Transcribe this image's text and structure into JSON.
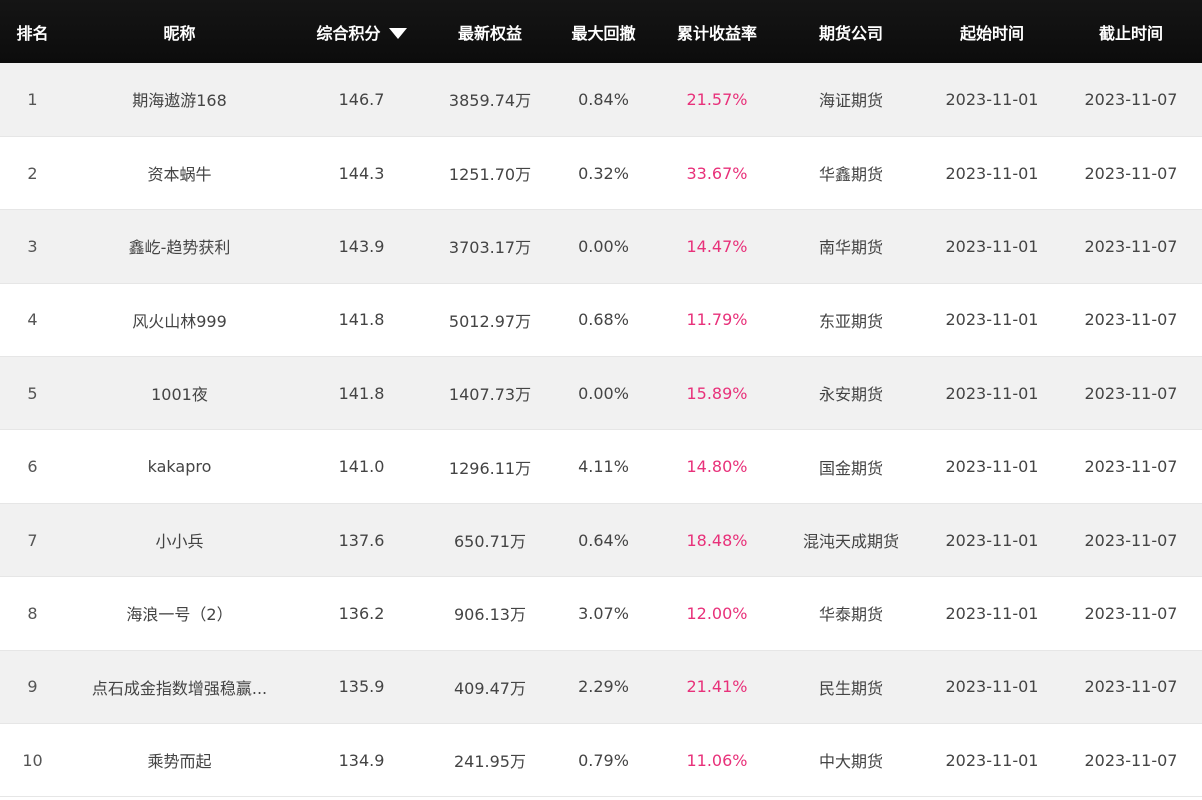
{
  "table": {
    "headers": {
      "rank": "排名",
      "nickname": "昵称",
      "score": "综合积分",
      "equity": "最新权益",
      "drawdown": "最大回撤",
      "return": "累计收益率",
      "company": "期货公司",
      "start": "起始时间",
      "end": "截止时间"
    },
    "sort": {
      "column": "score",
      "direction": "desc",
      "icon": "caret-down-icon"
    },
    "colors": {
      "header_bg": "#111111",
      "return_text": "#e8317a",
      "odd_row": "#f1f1f1",
      "even_row": "#ffffff"
    },
    "rows": [
      {
        "rank": "1",
        "nickname": "期海遨游168",
        "score": "146.7",
        "equity": "3859.74万",
        "drawdown": "0.84%",
        "return": "21.57%",
        "company": "海证期货",
        "start": "2023-11-01",
        "end": "2023-11-07"
      },
      {
        "rank": "2",
        "nickname": "资本蜗牛",
        "score": "144.3",
        "equity": "1251.70万",
        "drawdown": "0.32%",
        "return": "33.67%",
        "company": "华鑫期货",
        "start": "2023-11-01",
        "end": "2023-11-07"
      },
      {
        "rank": "3",
        "nickname": "鑫屹-趋势获利",
        "score": "143.9",
        "equity": "3703.17万",
        "drawdown": "0.00%",
        "return": "14.47%",
        "company": "南华期货",
        "start": "2023-11-01",
        "end": "2023-11-07"
      },
      {
        "rank": "4",
        "nickname": "风火山林999",
        "score": "141.8",
        "equity": "5012.97万",
        "drawdown": "0.68%",
        "return": "11.79%",
        "company": "东亚期货",
        "start": "2023-11-01",
        "end": "2023-11-07"
      },
      {
        "rank": "5",
        "nickname": "1001夜",
        "score": "141.8",
        "equity": "1407.73万",
        "drawdown": "0.00%",
        "return": "15.89%",
        "company": "永安期货",
        "start": "2023-11-01",
        "end": "2023-11-07"
      },
      {
        "rank": "6",
        "nickname": "kakapro",
        "score": "141.0",
        "equity": "1296.11万",
        "drawdown": "4.11%",
        "return": "14.80%",
        "company": "国金期货",
        "start": "2023-11-01",
        "end": "2023-11-07"
      },
      {
        "rank": "7",
        "nickname": "小小兵",
        "score": "137.6",
        "equity": "650.71万",
        "drawdown": "0.64%",
        "return": "18.48%",
        "company": "混沌天成期货",
        "start": "2023-11-01",
        "end": "2023-11-07"
      },
      {
        "rank": "8",
        "nickname": "海浪一号（2）",
        "score": "136.2",
        "equity": "906.13万",
        "drawdown": "3.07%",
        "return": "12.00%",
        "company": "华泰期货",
        "start": "2023-11-01",
        "end": "2023-11-07"
      },
      {
        "rank": "9",
        "nickname": "点石成金指数增强稳赢...",
        "score": "135.9",
        "equity": "409.47万",
        "drawdown": "2.29%",
        "return": "21.41%",
        "company": "民生期货",
        "start": "2023-11-01",
        "end": "2023-11-07"
      },
      {
        "rank": "10",
        "nickname": "乘势而起",
        "score": "134.9",
        "equity": "241.95万",
        "drawdown": "0.79%",
        "return": "11.06%",
        "company": "中大期货",
        "start": "2023-11-01",
        "end": "2023-11-07"
      }
    ]
  }
}
